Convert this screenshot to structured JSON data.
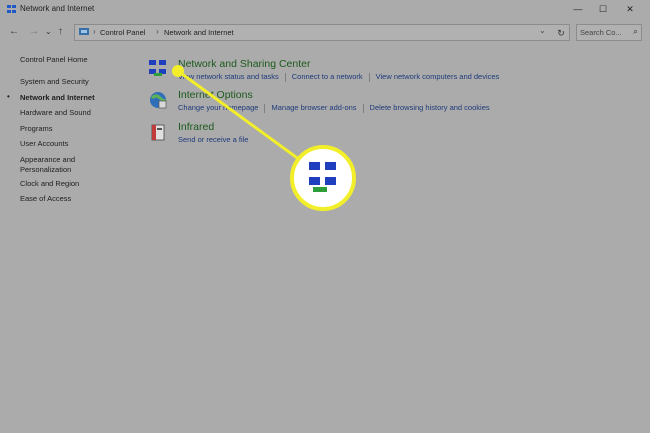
{
  "window": {
    "title": "Network and Internet"
  },
  "controls": {
    "minimize": "—",
    "maximize": "☐",
    "close": "✕"
  },
  "nav": {
    "back": "←",
    "forward": "→",
    "dropdown": "⌄",
    "up": "↑"
  },
  "address": {
    "crumbs": [
      "Control Panel",
      "Network and Internet"
    ],
    "dropdown": "⌄",
    "refresh": "↻"
  },
  "search": {
    "placeholder": "Search Co...",
    "icon": "⌕"
  },
  "sidebar": {
    "items": [
      {
        "label": "Control Panel Home"
      },
      {
        "label": "System and Security"
      },
      {
        "label": "Network and Internet"
      },
      {
        "label": "Hardware and Sound"
      },
      {
        "label": "Programs"
      },
      {
        "label": "User Accounts"
      },
      {
        "label": "Appearance and"
      },
      {
        "label": "Personalization"
      },
      {
        "label": "Clock and Region"
      },
      {
        "label": "Ease of Access"
      }
    ],
    "active_bullet": "•"
  },
  "categories": [
    {
      "title": "Network and Sharing Center",
      "links": [
        "View network status and tasks",
        "Connect to a network",
        "View network computers and devices"
      ]
    },
    {
      "title": "Internet Options",
      "links": [
        "Change your homepage",
        "Manage browser add-ons",
        "Delete browsing history and cookies"
      ]
    },
    {
      "title": "Infrared",
      "links": [
        "Send or receive a file"
      ]
    }
  ],
  "colors": {
    "background": "#ababab",
    "category_title": "#1c5a1c",
    "link": "#1e3a7a",
    "highlight": "#f2ef2a"
  },
  "icons": [
    "network-icon",
    "internet-options-icon",
    "infrared-icon",
    "back-arrow-icon",
    "forward-arrow-icon",
    "up-arrow-icon",
    "refresh-icon",
    "search-icon"
  ]
}
